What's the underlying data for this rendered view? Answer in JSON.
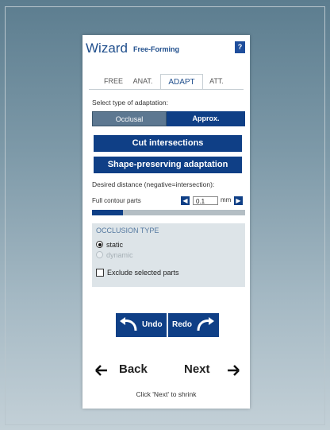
{
  "header": {
    "title": "Wizard",
    "subtitle": "Free-Forming",
    "help_label": "?"
  },
  "tabs": [
    {
      "label": "FREE",
      "active": false
    },
    {
      "label": "ANAT.",
      "active": false
    },
    {
      "label": "ADAPT",
      "active": true
    },
    {
      "label": "ATT.",
      "active": false
    }
  ],
  "adaptation": {
    "select_label": "Select type of adaptation:",
    "options": [
      {
        "label": "Occlusal",
        "selected": true
      },
      {
        "label": "Approx.",
        "selected": false
      }
    ],
    "cut_button": "Cut intersections",
    "shape_button": "Shape-preserving adaptation"
  },
  "distance": {
    "label": "Desired distance (negative=intersection):",
    "row_label": "Full contour parts",
    "value": "0.1",
    "unit": "mm",
    "slider_level": 0.2
  },
  "occlusion": {
    "title": "OCCLUSION TYPE",
    "options": [
      {
        "label": "static",
        "selected": true,
        "enabled": true
      },
      {
        "label": "dynamic",
        "selected": false,
        "enabled": false
      }
    ],
    "exclude_label": "Exclude selected parts",
    "exclude_checked": false
  },
  "actions": {
    "undo": "Undo",
    "redo": "Redo"
  },
  "navigation": {
    "back": "Back",
    "next": "Next",
    "hint": "Click 'Next' to shrink"
  },
  "colors": {
    "primary": "#0f3f86",
    "selected_segment": "#5d7891",
    "occlusion_panel": "#dde4e8",
    "background": "#7d99a8"
  }
}
